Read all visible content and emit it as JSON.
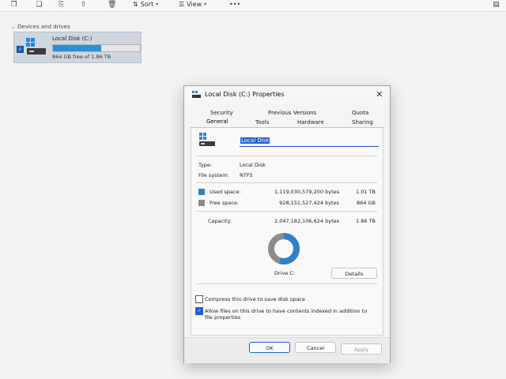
{
  "explorer": {
    "toolbar": {
      "sort_label": "Sort",
      "view_label": "View",
      "more_label": "•••"
    },
    "section_title": "Devices and drives",
    "drive": {
      "name": "Local Disk (C:)",
      "free_text": "864 GB free of 1.86 TB",
      "used_fraction": 0.55,
      "bar_color": "#2e8fd6"
    }
  },
  "dialog": {
    "title": "Local Disk (C:) Properties",
    "tabs_row1": [
      "Security",
      "Previous Versions",
      "Quota"
    ],
    "tabs_row2": [
      "General",
      "Tools",
      "Hardware",
      "Sharing"
    ],
    "active_tab": "General",
    "drive_name_value": "Local Disk",
    "type_label": "Type:",
    "type_value": "Local Disk",
    "fs_label": "File system:",
    "fs_value": "NTFS",
    "used_label": "Used space:",
    "used_bytes": "1,119,030,579,200 bytes",
    "used_size": "1.01 TB",
    "free_label": "Free space:",
    "free_bytes": "928,151,527,424 bytes",
    "free_size": "864 GB",
    "capacity_label": "Capacity:",
    "capacity_bytes": "2,047,182,106,624 bytes",
    "capacity_size": "1.86 TB",
    "drive_label": "Drive C:",
    "details_button": "Details",
    "compress_label": "Compress this drive to save disk space",
    "compress_checked": false,
    "index_label": "Allow files on this drive to have contents indexed in addition to file properties",
    "index_checked": true,
    "ok_button": "OK",
    "cancel_button": "Cancel",
    "apply_button": "Apply",
    "used_fraction": 0.547,
    "colors": {
      "used": "#2f80c8",
      "free": "#8c8c8c",
      "accent": "#1f5fd0"
    }
  }
}
